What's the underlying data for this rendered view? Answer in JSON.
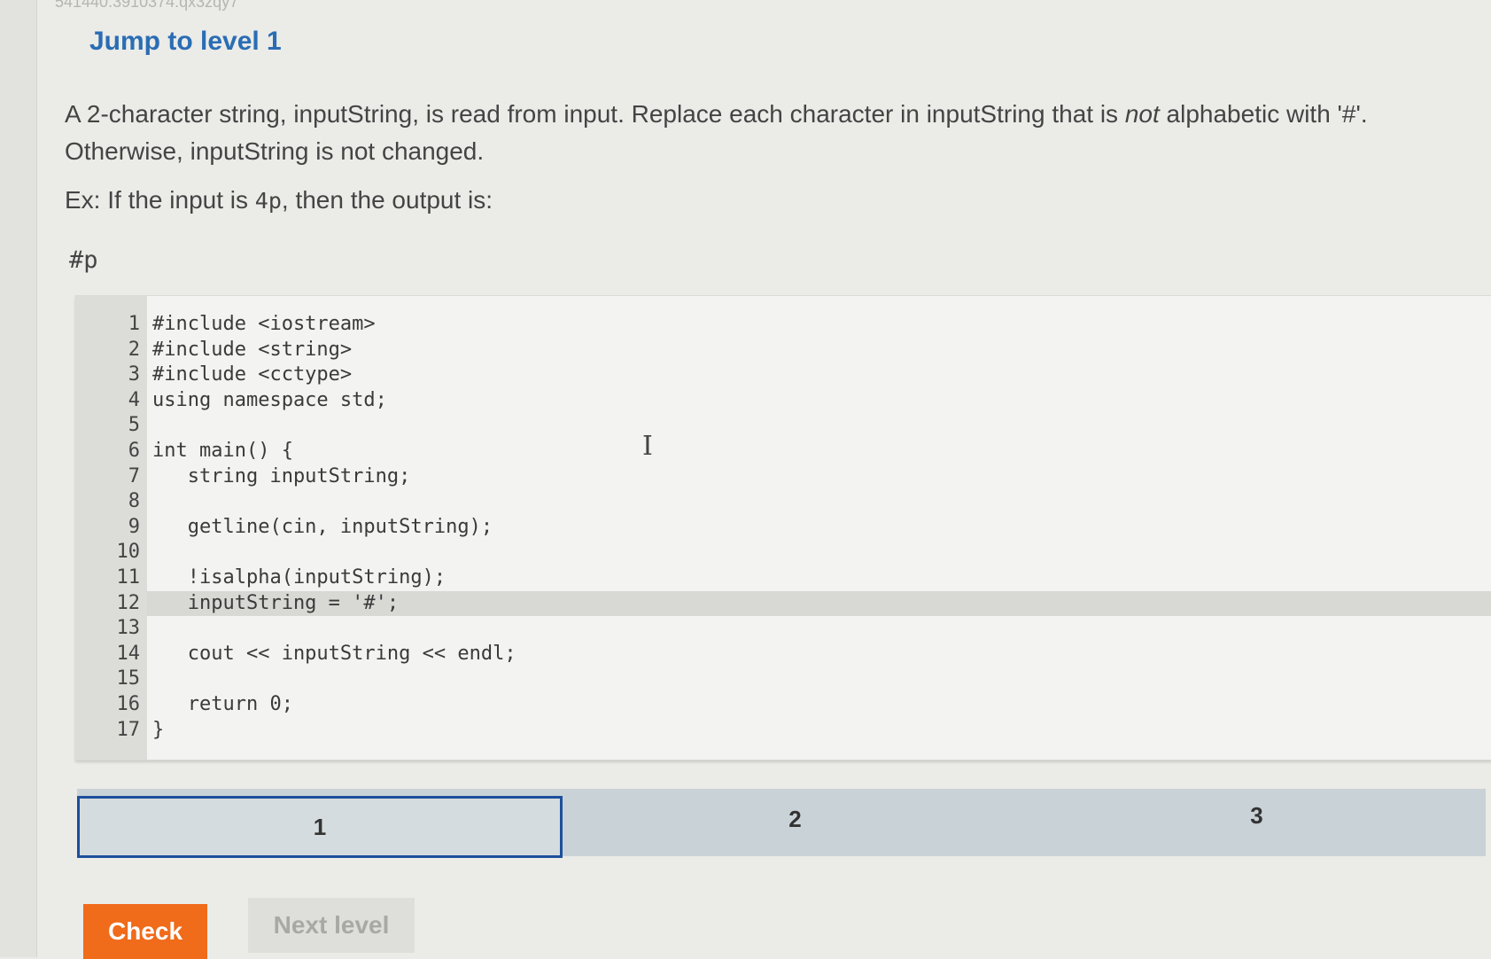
{
  "header": {
    "id_text": "541440.3910374.qx3zqy7",
    "title": "Jump to level 1"
  },
  "prompt": {
    "p1_a": "A 2-character string, inputString, is read from input. Replace each character in inputString that is ",
    "p1_em": "not",
    "p1_b": " alphabetic with '#'. Otherwise, inputString is not changed.",
    "example_a": "Ex: If the input is ",
    "example_input": "4p",
    "example_b": ", then the output is:",
    "example_output": "#p"
  },
  "code": {
    "lines": [
      {
        "n": "1",
        "t": "#include <iostream>"
      },
      {
        "n": "2",
        "t": "#include <string>"
      },
      {
        "n": "3",
        "t": "#include <cctype>"
      },
      {
        "n": "4",
        "t": "using namespace std;"
      },
      {
        "n": "5",
        "t": ""
      },
      {
        "n": "6",
        "t": "int main() {"
      },
      {
        "n": "7",
        "t": "   string inputString;"
      },
      {
        "n": "8",
        "t": ""
      },
      {
        "n": "9",
        "t": "   getline(cin, inputString);"
      },
      {
        "n": "10",
        "t": ""
      },
      {
        "n": "11",
        "t": "   !isalpha(inputString);"
      },
      {
        "n": "12",
        "t": "   inputString = '#';"
      },
      {
        "n": "13",
        "t": ""
      },
      {
        "n": "14",
        "t": "   cout << inputString << endl;"
      },
      {
        "n": "15",
        "t": ""
      },
      {
        "n": "16",
        "t": "   return 0;"
      },
      {
        "n": "17",
        "t": "}"
      }
    ],
    "highlighted_line": "12"
  },
  "levels": [
    {
      "label": "1",
      "active": true
    },
    {
      "label": "2",
      "active": false
    },
    {
      "label": "3",
      "active": false
    }
  ],
  "buttons": {
    "check": "Check",
    "next": "Next level"
  },
  "colors": {
    "title": "#2a6db3",
    "check": "#f06b1a",
    "active_level_border": "#1d4f9c"
  }
}
